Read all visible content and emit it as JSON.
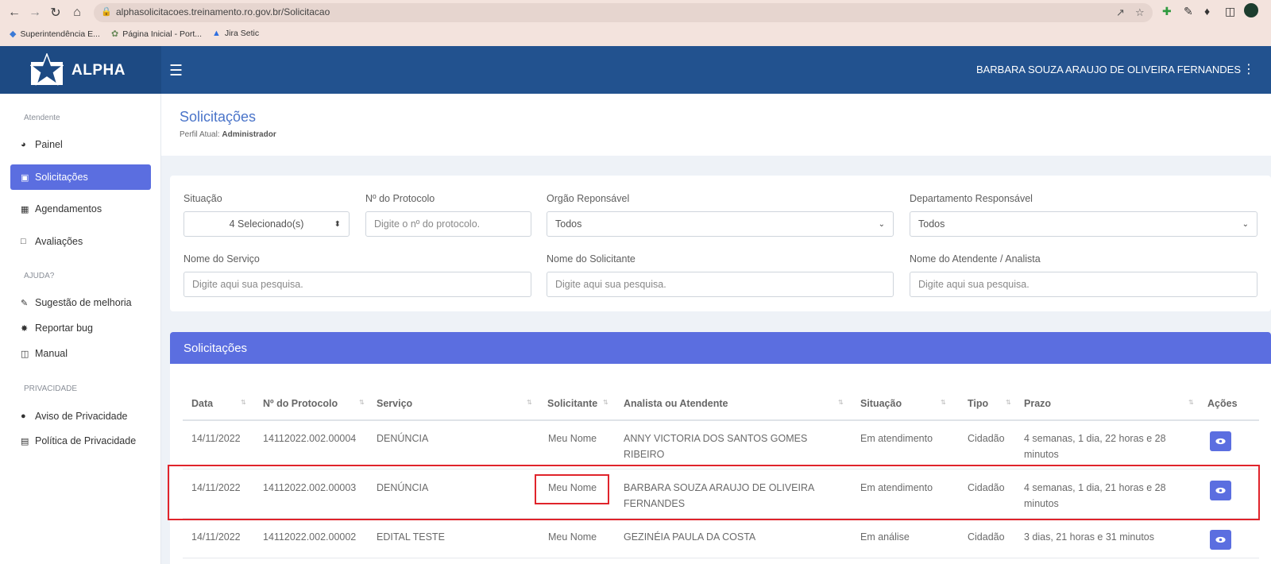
{
  "browser": {
    "url": "alphasolicitacoes.treinamento.ro.gov.br/Solicitacao",
    "bookmarks": [
      {
        "label": "Superintendência E..."
      },
      {
        "label": "Página Inicial - Port..."
      },
      {
        "label": "Jira Setic"
      }
    ]
  },
  "header": {
    "brand": "ALPHA",
    "user_name": "BARBARA SOUZA ARAUJO DE OLIVEIRA FERNANDES"
  },
  "sidebar": {
    "sections": [
      {
        "title": "Atendente"
      },
      {
        "title": "AJUDA?"
      },
      {
        "title": "PRIVACIDADE"
      }
    ],
    "items": [
      {
        "label": "Painel",
        "icon": "dashboard-icon"
      },
      {
        "label": "Solicitações",
        "icon": "clipboard-icon",
        "active": true
      },
      {
        "label": "Agendamentos",
        "icon": "calendar-icon"
      },
      {
        "label": "Avaliações",
        "icon": "comment-icon"
      },
      {
        "label": "Sugestão de melhoria",
        "icon": "edit-icon"
      },
      {
        "label": "Reportar bug",
        "icon": "bug-icon"
      },
      {
        "label": "Manual",
        "icon": "book-icon"
      },
      {
        "label": "Aviso de Privacidade",
        "icon": "info-icon"
      },
      {
        "label": "Política de Privacidade",
        "icon": "document-icon"
      }
    ]
  },
  "page": {
    "title": "Solicitações",
    "profile_label": "Perfil Atual:",
    "profile_value": "Administrador"
  },
  "filters": {
    "situacao": {
      "label": "Situação",
      "value": "4 Selecionado(s)"
    },
    "protocolo": {
      "label": "Nº do Protocolo",
      "placeholder": "Digite o nº do protocolo."
    },
    "orgao": {
      "label": "Orgão Reponsável",
      "value": "Todos"
    },
    "departamento": {
      "label": "Departamento Responsável",
      "value": "Todos"
    },
    "servico": {
      "label": "Nome do Serviço",
      "placeholder": "Digite aqui sua pesquisa."
    },
    "solicitante": {
      "label": "Nome do Solicitante",
      "placeholder": "Digite aqui sua pesquisa."
    },
    "atendente": {
      "label": "Nome do Atendente / Analista",
      "placeholder": "Digite aqui sua pesquisa."
    }
  },
  "table": {
    "title": "Solicitações",
    "columns": [
      "Data",
      "Nº do Protocolo",
      "Serviço",
      "Solicitante",
      "Analista ou Atendente",
      "Situação",
      "Tipo",
      "Prazo",
      "Ações"
    ],
    "rows": [
      {
        "data": "14/11/2022",
        "protocolo": "14112022.002.00004",
        "servico": "DENÚNCIA",
        "solicitante": "Meu Nome",
        "analista_l1": "ANNY VICTORIA DOS SANTOS GOMES",
        "analista_l2": "RIBEIRO",
        "situacao": "Em atendimento",
        "tipo": "Cidadão",
        "prazo_l1": "4 semanas, 1 dia, 22 horas e 28",
        "prazo_l2": "minutos"
      },
      {
        "data": "14/11/2022",
        "protocolo": "14112022.002.00003",
        "servico": "DENÚNCIA",
        "solicitante": "Meu Nome",
        "analista_l1": "BARBARA SOUZA ARAUJO DE OLIVEIRA",
        "analista_l2": "FERNANDES",
        "situacao": "Em atendimento",
        "tipo": "Cidadão",
        "prazo_l1": "4 semanas, 1 dia, 21 horas e 28",
        "prazo_l2": "minutos"
      },
      {
        "data": "14/11/2022",
        "protocolo": "14112022.002.00002",
        "servico": "EDITAL TESTE",
        "solicitante": "Meu Nome",
        "analista_l1": "GEZINÉIA PAULA DA COSTA",
        "analista_l2": "",
        "situacao": "Em análise",
        "tipo": "Cidadão",
        "prazo_l1": "3 dias, 21 horas e 31 minutos",
        "prazo_l2": ""
      }
    ]
  },
  "colors": {
    "primary": "#5b6ee0",
    "header": "#22528f",
    "highlight": "#e0242b"
  }
}
